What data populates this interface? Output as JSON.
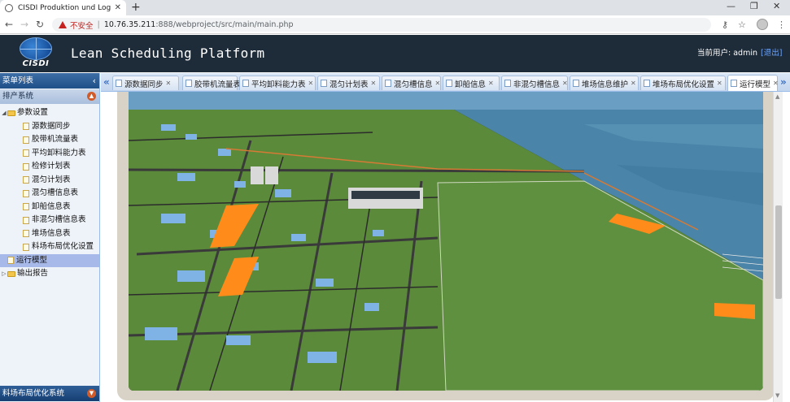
{
  "browser": {
    "tab_title": "CISDI Produktion und Logistik",
    "not_secure": "不安全",
    "url_host": "10.76.35.211",
    "url_rest": ":888/webproject/src/main/main.php"
  },
  "header": {
    "logo_text": "CISDI",
    "title": "Lean Scheduling Platform",
    "user_label": "当前用户: admin",
    "logout": "[退出]"
  },
  "sidebar": {
    "menu_title": "菜单列表",
    "panel_title": "排产系统",
    "tree": [
      {
        "label": "参数设置",
        "type": "folder",
        "level": 0,
        "expanded": true
      },
      {
        "label": "源数据同步",
        "type": "page",
        "level": 1
      },
      {
        "label": "胶带机流量表",
        "type": "page",
        "level": 1
      },
      {
        "label": "平均卸料能力表",
        "type": "page",
        "level": 1
      },
      {
        "label": "检修计划表",
        "type": "page",
        "level": 1
      },
      {
        "label": "混匀计划表",
        "type": "page",
        "level": 1
      },
      {
        "label": "混匀槽信息表",
        "type": "page",
        "level": 1
      },
      {
        "label": "卸船信息表",
        "type": "page",
        "level": 1
      },
      {
        "label": "非混匀槽信息表",
        "type": "page",
        "level": 1
      },
      {
        "label": "堆场信息表",
        "type": "page",
        "level": 1
      },
      {
        "label": "料场布局优化设置",
        "type": "page",
        "level": 1
      },
      {
        "label": "运行模型",
        "type": "page",
        "level": 0,
        "selected": true
      },
      {
        "label": "输出报告",
        "type": "folder",
        "level": 0,
        "expanded": false
      }
    ],
    "bottom_panel": "料场布局优化系统"
  },
  "tabs": [
    {
      "label": "源数据同步"
    },
    {
      "label": "胶带机流量表"
    },
    {
      "label": "平均卸料能力表"
    },
    {
      "label": "混匀计划表"
    },
    {
      "label": "混匀槽信息"
    },
    {
      "label": "卸船信息"
    },
    {
      "label": "非混匀槽信息"
    },
    {
      "label": "堆场信息维护"
    },
    {
      "label": "堆场布局优化设置"
    },
    {
      "label": "运行模型",
      "active": true
    }
  ],
  "colors": {
    "header_bg": "#1e2b38",
    "sea": "#4a84a8",
    "ground": "#5b8a3a",
    "stockpile": "#ff8c1a"
  }
}
